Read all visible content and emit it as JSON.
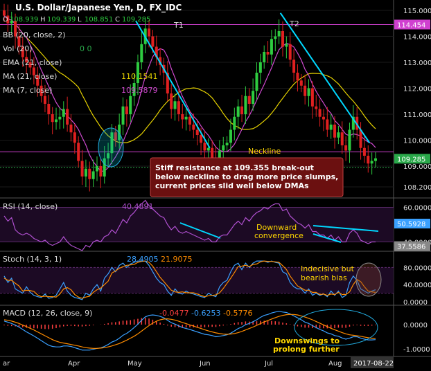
{
  "header": {
    "title": "U.S. Dollar/Japanese Yen, D, FX_IDC",
    "ohlc": [
      {
        "k": "O",
        "v": "108.939"
      },
      {
        "k": "H",
        "v": "109.339"
      },
      {
        "k": "L",
        "v": "108.851"
      },
      {
        "k": "C",
        "v": "109.285"
      }
    ]
  },
  "indicators": [
    {
      "label": "BB (20, close, 2)",
      "value": "",
      "color": "#3aa0ff"
    },
    {
      "label": "Vol (20)",
      "value": "0 0",
      "color": "#2aa84a"
    },
    {
      "label": "EMA (21, close)",
      "value": "",
      "color": "#3aa0ff"
    },
    {
      "label": "MA (21, close)",
      "value": "110.1541",
      "color": "#e6d200"
    },
    {
      "label": "MA (7, close)",
      "value": "109.5879",
      "color": "#d04ad0"
    }
  ],
  "colors": {
    "up": "#2ecc40",
    "down": "#e02020",
    "ma21": "#e6d200",
    "ma7": "#d04ad0",
    "trend": "#00d8ff",
    "resistance": "#d040d0",
    "annotation": "#ffd700",
    "rsi": "#b050d0",
    "stochK": "#3aa0ff",
    "stochD": "#ff8c00",
    "macd": "#3aa0ff",
    "signal": "#ff8c00",
    "hist": "#ff4040"
  },
  "annotations": {
    "t1": "T1",
    "t2": "T2",
    "neckline": "Neckline",
    "callout": [
      "Stiff resistance at 109.355 break-out",
      "below neckline to drag more price slumps,",
      "current prices slid well below DMAs"
    ],
    "rsi_note": [
      "Downward",
      "convergence"
    ],
    "stoch_note": [
      "Indecisive but",
      "bearish bias"
    ],
    "macd_note": [
      "Downswings to",
      "prolong further"
    ]
  },
  "chart_data": [
    {
      "type": "candlestick",
      "ylim": [
        107.8,
        115.4
      ],
      "yticks": [
        "115.000",
        "114.000",
        "113.000",
        "112.000",
        "111.000",
        "110.000",
        "109.000",
        "108.200"
      ],
      "price_labels": [
        {
          "value": "114.454",
          "color": "#d040d0"
        },
        {
          "value": "109.285",
          "color": "#2aa84a"
        }
      ],
      "x_labels": [
        "ar",
        "Apr",
        "May",
        "Jun",
        "Jul",
        "Aug",
        "2017-08-22"
      ],
      "close": [
        114.8,
        114.5,
        114.6,
        114.0,
        113.6,
        113.2,
        113.0,
        112.8,
        112.5,
        112.1,
        111.7,
        111.4,
        111.0,
        110.7,
        110.8,
        110.9,
        111.2,
        110.6,
        110.3,
        109.9,
        109.2,
        108.6,
        108.9,
        108.5,
        108.8,
        109.0,
        108.6,
        109.3,
        109.5,
        110.3,
        110.0,
        110.6,
        111.3,
        111.0,
        111.7,
        112.2,
        113.0,
        113.7,
        114.3,
        114.0,
        113.6,
        113.2,
        112.9,
        112.6,
        111.8,
        111.2,
        111.5,
        111.0,
        110.8,
        110.9,
        110.6,
        110.4,
        110.2,
        109.9,
        109.6,
        109.7,
        109.3,
        109.0,
        109.6,
        109.8,
        109.9,
        110.4,
        110.9,
        111.3,
        111.0,
        111.7,
        111.4,
        111.9,
        112.6,
        113.0,
        113.4,
        113.3,
        113.9,
        114.0,
        114.2,
        113.6,
        113.7,
        113.1,
        112.6,
        112.3,
        112.1,
        111.7,
        112.0,
        111.3,
        111.2,
        110.9,
        110.8,
        110.4,
        110.6,
        110.1,
        110.3,
        109.8,
        109.6,
        110.4,
        110.9,
        110.4,
        109.7,
        109.4,
        109.1,
        109.2,
        109.3
      ],
      "neckline": 109.35,
      "resistance": [
        114.454,
        109.55
      ]
    },
    {
      "type": "line",
      "name": "RSI (14, close)",
      "value": "40.4891",
      "ylim": [
        35,
        65
      ],
      "yticks": [
        "60.0000",
        "40.0000"
      ],
      "price_labels": [
        {
          "value": "50.5928",
          "color": "#3aa0ff"
        },
        {
          "value": "37.5586",
          "color": "#888"
        }
      ],
      "values": [
        55,
        52,
        54,
        47,
        45,
        44,
        45,
        44,
        42,
        41,
        40,
        41,
        39,
        38,
        39,
        40,
        43,
        40,
        38,
        37,
        36,
        35,
        38,
        37,
        40,
        41,
        40,
        43,
        44,
        47,
        45,
        49,
        53,
        51,
        55,
        57,
        60,
        62,
        64,
        61,
        59,
        57,
        55,
        54,
        50,
        47,
        49,
        46,
        45,
        46,
        45,
        44,
        43,
        42,
        41,
        42,
        40,
        40,
        43,
        44,
        44,
        47,
        50,
        52,
        50,
        54,
        52,
        55,
        57,
        58,
        60,
        59,
        61,
        62,
        62,
        58,
        59,
        55,
        53,
        51,
        50,
        48,
        50,
        46,
        46,
        44,
        44,
        42,
        44,
        41,
        43,
        40,
        40,
        45,
        47,
        45,
        41,
        40,
        39,
        40,
        40
      ]
    },
    {
      "type": "line",
      "name": "Stoch (14, 3, 1)",
      "values_label": [
        "28.4905",
        "21.9075"
      ],
      "ylim": [
        0,
        100
      ],
      "yticks": [
        "80.0000",
        "40.0000",
        "0.0000"
      ],
      "k": [
        60,
        45,
        55,
        30,
        25,
        20,
        35,
        22,
        15,
        12,
        10,
        18,
        8,
        10,
        15,
        30,
        45,
        25,
        15,
        10,
        8,
        5,
        20,
        15,
        30,
        40,
        25,
        55,
        65,
        80,
        70,
        85,
        90,
        80,
        88,
        92,
        95,
        95,
        95,
        85,
        70,
        55,
        45,
        40,
        25,
        15,
        30,
        20,
        18,
        25,
        20,
        18,
        15,
        12,
        10,
        20,
        15,
        12,
        35,
        45,
        50,
        70,
        85,
        90,
        75,
        90,
        80,
        90,
        95,
        95,
        95,
        92,
        95,
        92,
        90,
        70,
        65,
        45,
        35,
        30,
        30,
        20,
        30,
        15,
        20,
        15,
        18,
        12,
        25,
        15,
        25,
        10,
        15,
        45,
        60,
        50,
        30,
        25,
        20,
        25,
        28
      ],
      "d": [
        55,
        50,
        50,
        43,
        37,
        25,
        27,
        26,
        24,
        16,
        12,
        13,
        12,
        12,
        11,
        18,
        30,
        33,
        28,
        17,
        11,
        8,
        11,
        13,
        22,
        28,
        32,
        40,
        48,
        67,
        72,
        78,
        82,
        85,
        86,
        87,
        92,
        94,
        95,
        92,
        83,
        70,
        57,
        47,
        37,
        27,
        23,
        22,
        23,
        21,
        21,
        21,
        18,
        15,
        12,
        14,
        15,
        16,
        21,
        31,
        43,
        55,
        68,
        82,
        83,
        85,
        82,
        87,
        88,
        93,
        95,
        94,
        94,
        93,
        92,
        84,
        75,
        60,
        48,
        37,
        32,
        27,
        27,
        22,
        22,
        17,
        18,
        15,
        18,
        17,
        22,
        17,
        17,
        23,
        40,
        52,
        47,
        35,
        25,
        23,
        22
      ]
    },
    {
      "type": "macd",
      "name": "MACD (12, 26, close, 9)",
      "values_label": [
        "-0.0477",
        "-0.6253",
        "-0.5776"
      ],
      "ylim": [
        -1.2,
        0.6
      ],
      "yticks": [
        "0.0000",
        "-1.0000"
      ],
      "macd": [
        0.15,
        0.1,
        0.05,
        -0.02,
        -0.1,
        -0.2,
        -0.3,
        -0.38,
        -0.47,
        -0.56,
        -0.66,
        -0.76,
        -0.85,
        -0.9,
        -0.92,
        -0.92,
        -0.88,
        -0.88,
        -0.9,
        -0.95,
        -1.0,
        -1.05,
        -1.05,
        -1.05,
        -1.02,
        -0.98,
        -0.96,
        -0.9,
        -0.82,
        -0.72,
        -0.66,
        -0.56,
        -0.44,
        -0.36,
        -0.25,
        -0.12,
        0.02,
        0.18,
        0.32,
        0.38,
        0.4,
        0.38,
        0.34,
        0.28,
        0.18,
        0.08,
        0.02,
        -0.05,
        -0.12,
        -0.16,
        -0.2,
        -0.25,
        -0.3,
        -0.35,
        -0.4,
        -0.42,
        -0.45,
        -0.5,
        -0.48,
        -0.45,
        -0.42,
        -0.35,
        -0.26,
        -0.16,
        -0.1,
        0.0,
        0.05,
        0.12,
        0.2,
        0.3,
        0.38,
        0.42,
        0.48,
        0.52,
        0.55,
        0.52,
        0.5,
        0.44,
        0.36,
        0.28,
        0.2,
        0.1,
        0.05,
        -0.04,
        -0.12,
        -0.2,
        -0.26,
        -0.34,
        -0.38,
        -0.45,
        -0.48,
        -0.55,
        -0.6,
        -0.56,
        -0.5,
        -0.5,
        -0.56,
        -0.6,
        -0.63,
        -0.63,
        -0.62
      ],
      "signal": [
        0.2,
        0.18,
        0.15,
        0.1,
        0.05,
        -0.02,
        -0.08,
        -0.15,
        -0.22,
        -0.3,
        -0.38,
        -0.46,
        -0.54,
        -0.62,
        -0.68,
        -0.73,
        -0.76,
        -0.79,
        -0.82,
        -0.85,
        -0.88,
        -0.92,
        -0.95,
        -0.97,
        -0.98,
        -0.98,
        -0.97,
        -0.95,
        -0.92,
        -0.88,
        -0.83,
        -0.78,
        -0.71,
        -0.64,
        -0.56,
        -0.48,
        -0.38,
        -0.27,
        -0.15,
        -0.04,
        0.06,
        0.14,
        0.2,
        0.23,
        0.24,
        0.22,
        0.19,
        0.14,
        0.09,
        0.04,
        -0.01,
        -0.06,
        -0.11,
        -0.16,
        -0.21,
        -0.26,
        -0.3,
        -0.34,
        -0.37,
        -0.39,
        -0.4,
        -0.39,
        -0.37,
        -0.33,
        -0.28,
        -0.22,
        -0.16,
        -0.1,
        -0.03,
        0.04,
        0.11,
        0.17,
        0.23,
        0.29,
        0.34,
        0.38,
        0.41,
        0.42,
        0.42,
        0.4,
        0.36,
        0.31,
        0.26,
        0.2,
        0.13,
        0.06,
        -0.01,
        -0.08,
        -0.15,
        -0.21,
        -0.27,
        -0.33,
        -0.38,
        -0.42,
        -0.44,
        -0.46,
        -0.48,
        -0.51,
        -0.54,
        -0.56,
        -0.58
      ]
    }
  ]
}
